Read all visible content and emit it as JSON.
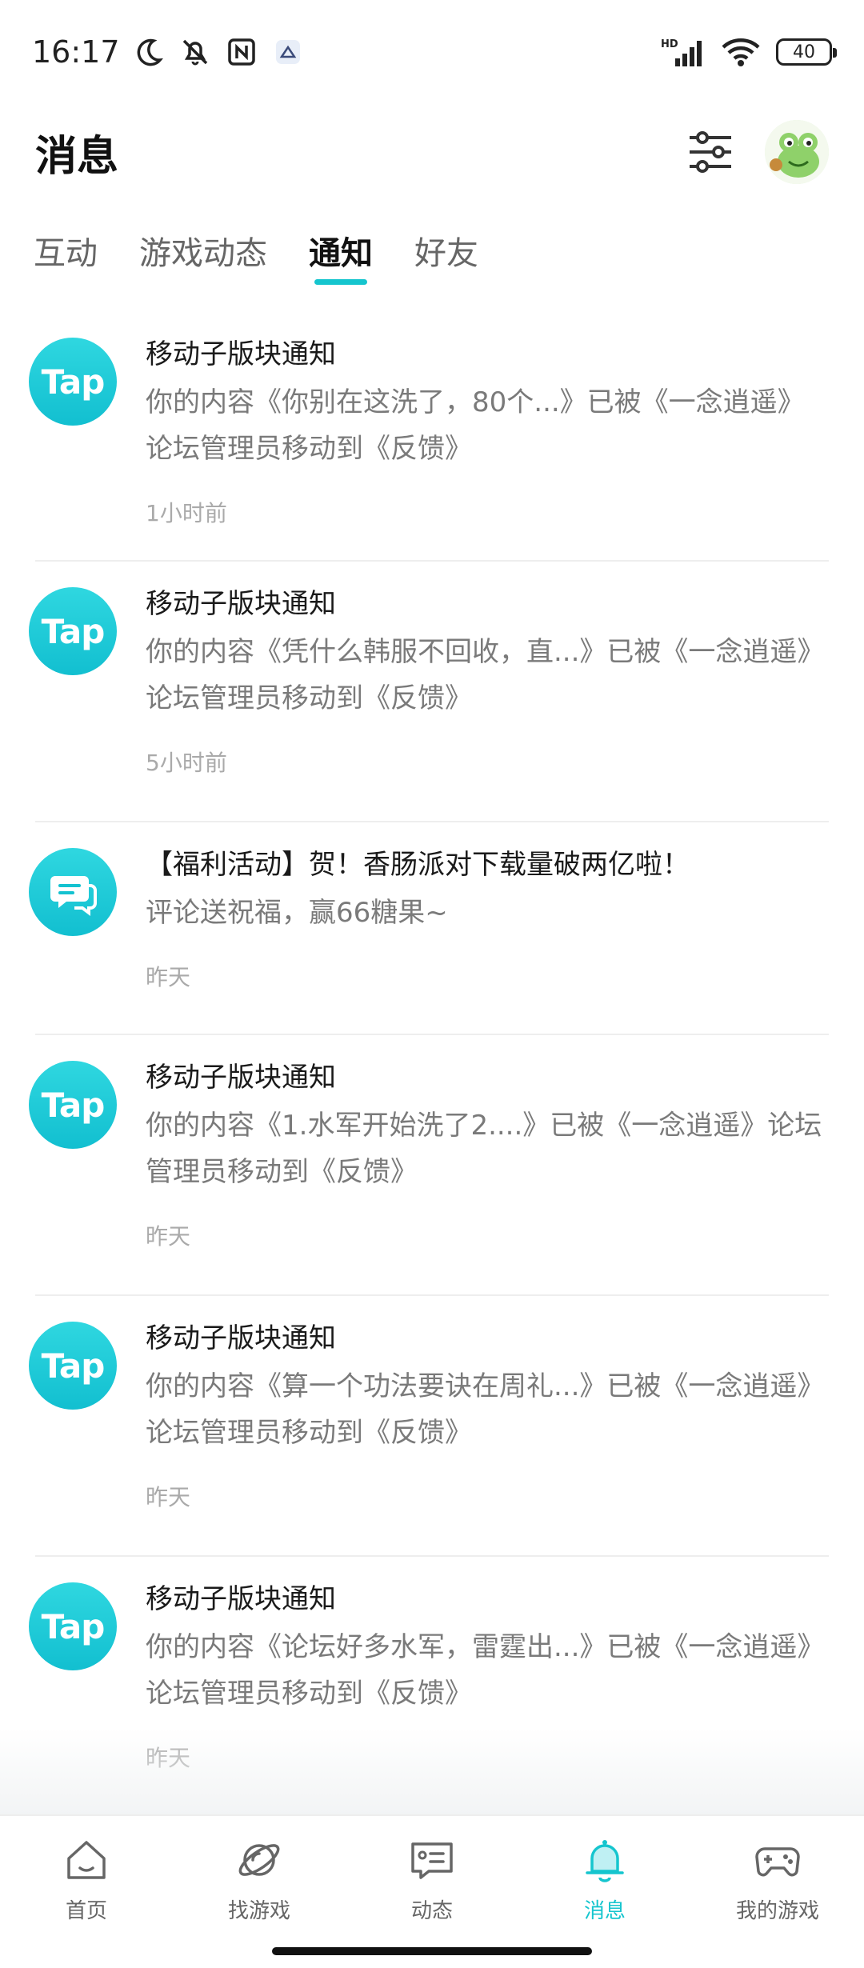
{
  "status_bar": {
    "time": "16:17",
    "battery": "40",
    "network": "HD"
  },
  "header": {
    "title": "消息"
  },
  "tabs": [
    {
      "label": "互动",
      "active": false
    },
    {
      "label": "游戏动态",
      "active": false
    },
    {
      "label": "通知",
      "active": true
    },
    {
      "label": "好友",
      "active": false
    }
  ],
  "notifications": [
    {
      "icon": "tap-logo",
      "icon_text": "Tap",
      "title": "移动子版块通知",
      "content": "你的内容《你别在这洗了，80个...》已被《一念逍遥》论坛管理员移动到《反馈》",
      "time": "1小时前"
    },
    {
      "icon": "tap-logo",
      "icon_text": "Tap",
      "title": "移动子版块通知",
      "content": "你的内容《凭什么韩服不回收，直...》已被《一念逍遥》论坛管理员移动到《反馈》",
      "time": "5小时前"
    },
    {
      "icon": "chat-bubble-icon",
      "title": "【福利活动】贺！香肠派对下载量破两亿啦！",
      "content": "评论送祝福，赢66糖果~",
      "time": "昨天"
    },
    {
      "icon": "tap-logo",
      "icon_text": "Tap",
      "title": "移动子版块通知",
      "content": "你的内容《1.水军开始洗了2....》已被《一念逍遥》论坛管理员移动到《反馈》",
      "time": "昨天"
    },
    {
      "icon": "tap-logo",
      "icon_text": "Tap",
      "title": "移动子版块通知",
      "content": "你的内容《算一个功法要诀在周礼...》已被《一念逍遥》论坛管理员移动到《反馈》",
      "time": "昨天"
    },
    {
      "icon": "tap-logo",
      "icon_text": "Tap",
      "title": "移动子版块通知",
      "content": "你的内容《论坛好多水军，雷霆出...》已被《一念逍遥》论坛管理员移动到《反馈》",
      "time": "昨天"
    }
  ],
  "bottom_nav": [
    {
      "label": "首页",
      "icon": "home-icon",
      "active": false
    },
    {
      "label": "找游戏",
      "icon": "planet-icon",
      "active": false
    },
    {
      "label": "动态",
      "icon": "feed-icon",
      "active": false
    },
    {
      "label": "消息",
      "icon": "bell-icon",
      "active": true
    },
    {
      "label": "我的游戏",
      "icon": "gamepad-icon",
      "active": false
    }
  ],
  "colors": {
    "accent": "#15c5ce",
    "text_primary": "#1a1a1a",
    "text_secondary": "#7a7a7a",
    "text_tertiary": "#aaaaaa"
  }
}
